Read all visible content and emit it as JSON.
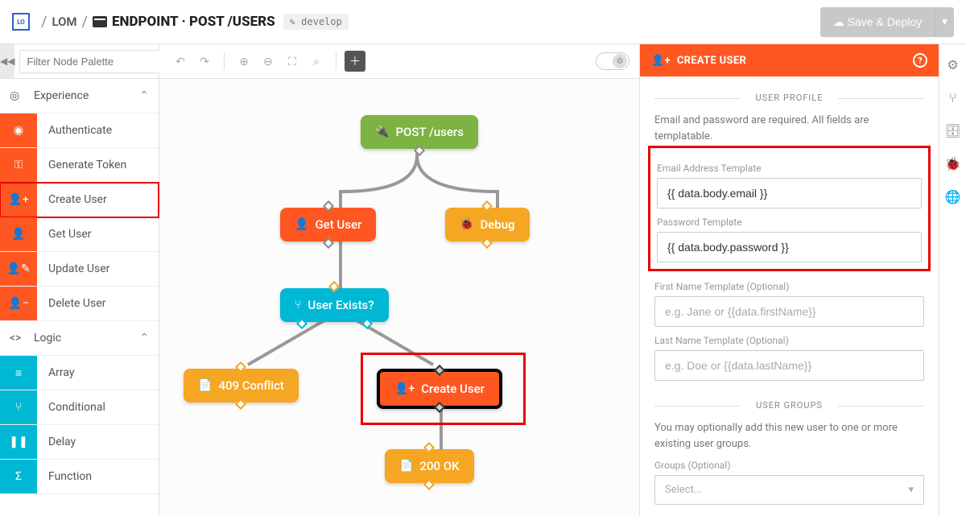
{
  "header": {
    "logo": "LO",
    "crumb1": "LOM",
    "endpoint_label": "ENDPOINT",
    "endpoint_name": "POST /USERS",
    "branch": "develop",
    "save_label": "Save & Deploy"
  },
  "palette": {
    "filter_placeholder": "Filter Node Palette",
    "cat_experience": "Experience",
    "items_exp": [
      "Authenticate",
      "Generate Token",
      "Create User",
      "Get User",
      "Update User",
      "Delete User"
    ],
    "cat_logic": "Logic",
    "items_logic": [
      "Array",
      "Conditional",
      "Delay",
      "Function"
    ]
  },
  "nodes": {
    "post": "POST /users",
    "getuser": "Get User",
    "debug": "Debug",
    "exists": "User Exists?",
    "conflict": "409 Conflict",
    "create": "Create User",
    "ok": "200 OK"
  },
  "panel": {
    "title": "CREATE USER",
    "section_profile": "USER PROFILE",
    "profile_desc": "Email and password are required. All fields are templatable.",
    "email_label": "Email Address Template",
    "email_value": "{{ data.body.email }}",
    "password_label": "Password Template",
    "password_value": "{{ data.body.password }}",
    "fname_label": "First Name Template (Optional)",
    "fname_ph": "e.g. Jane or {{data.firstName}}",
    "lname_label": "Last Name Template (Optional)",
    "lname_ph": "e.g. Doe or {{data.lastName}}",
    "section_groups": "USER GROUPS",
    "groups_desc": "You may optionally add this new user to one or more existing user groups.",
    "groups_label": "Groups (Optional)",
    "groups_select": "Select..."
  }
}
